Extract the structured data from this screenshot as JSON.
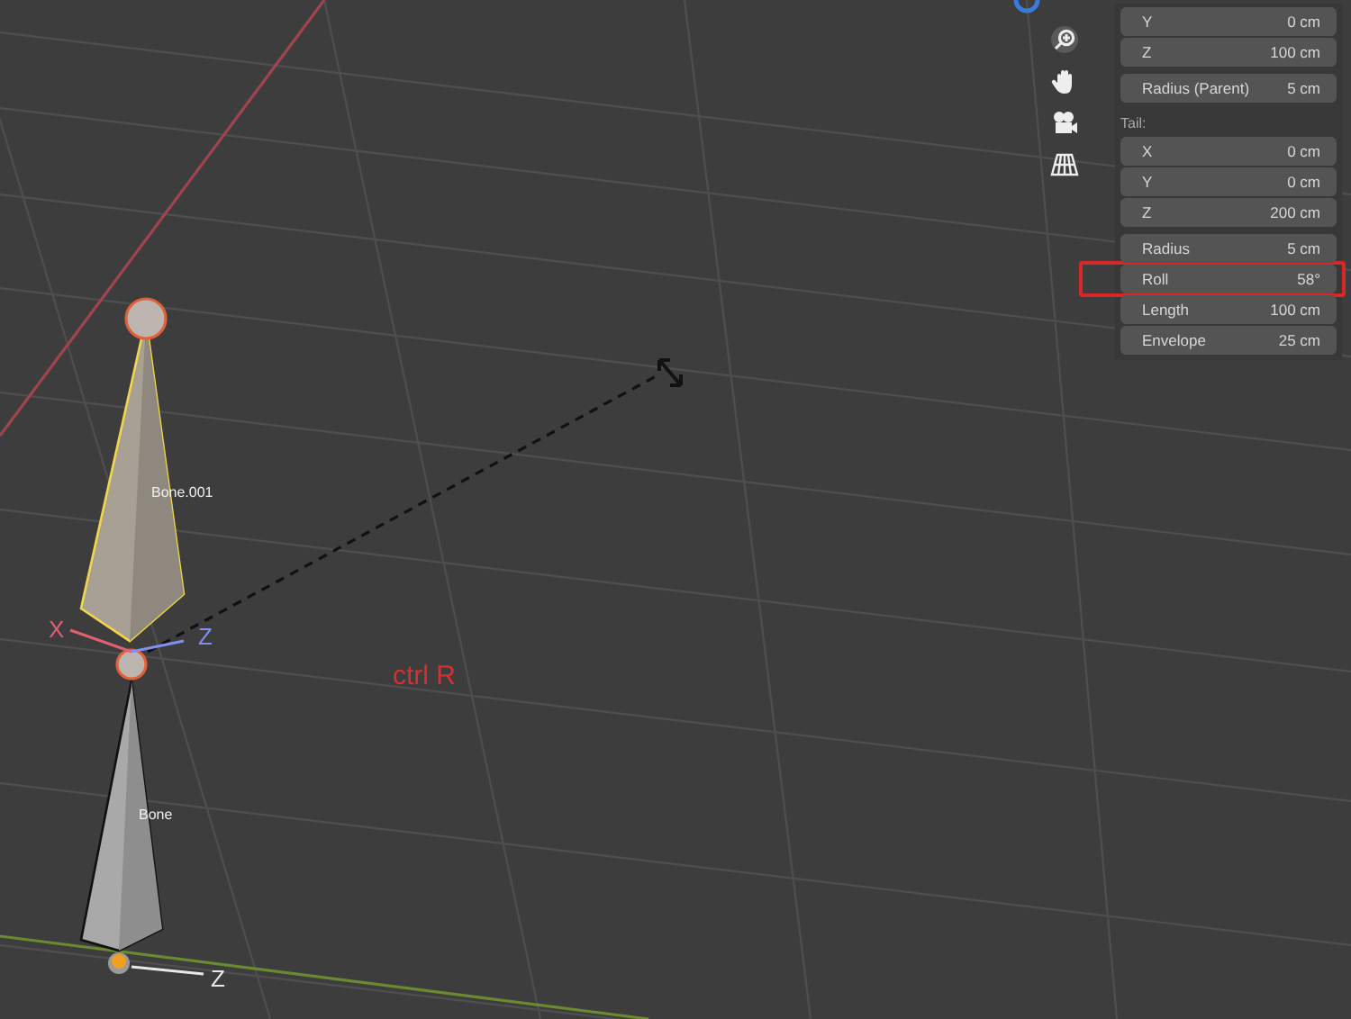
{
  "viewport": {
    "bones": [
      {
        "name": "Bone.001",
        "selected": true
      },
      {
        "name": "Bone",
        "selected": false
      }
    ],
    "axis_labels": [
      {
        "text": "X",
        "color": "#e06070"
      },
      {
        "text": "Z",
        "color": "#8090f0"
      },
      {
        "text": "Z",
        "color": "#e8e8e8"
      }
    ],
    "hint": "ctrl R"
  },
  "panel": {
    "groups": [
      {
        "fields": [
          {
            "label": "Y",
            "value": "0 cm",
            "highlighted": false
          },
          {
            "label": "Z",
            "value": "100 cm",
            "highlighted": false
          }
        ]
      },
      {
        "fields": [
          {
            "label": "Radius (Parent)",
            "value": "5 cm",
            "highlighted": false
          }
        ]
      },
      {
        "heading": "Tail:",
        "fields": [
          {
            "label": "X",
            "value": "0 cm",
            "highlighted": false
          },
          {
            "label": "Y",
            "value": "0 cm",
            "highlighted": false
          },
          {
            "label": "Z",
            "value": "200 cm",
            "highlighted": false
          }
        ]
      },
      {
        "fields": [
          {
            "label": "Radius",
            "value": "5 cm",
            "highlighted": false
          },
          {
            "label": "Roll",
            "value": "58°",
            "highlighted": true
          },
          {
            "label": "Length",
            "value": "100 cm",
            "highlighted": false
          },
          {
            "label": "Envelope",
            "value": "25 cm",
            "highlighted": false
          }
        ]
      }
    ]
  }
}
